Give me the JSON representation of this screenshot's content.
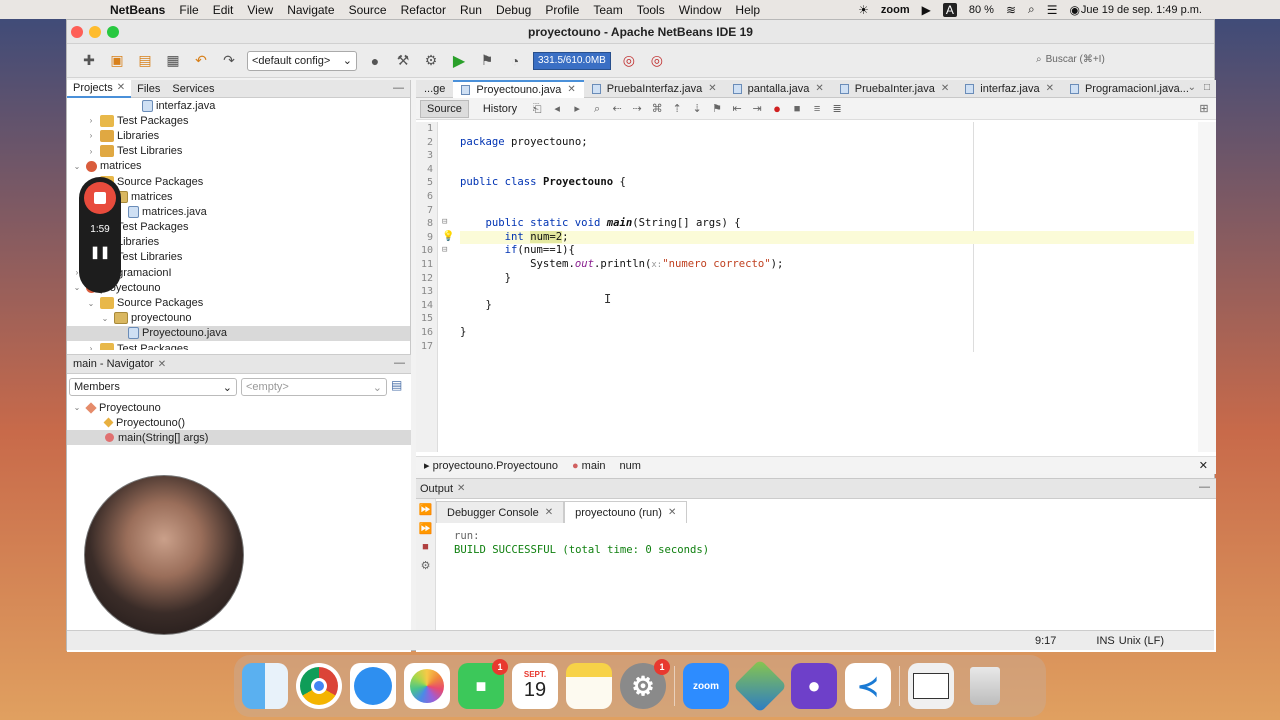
{
  "menubar": {
    "app_name": "NetBeans",
    "items": [
      "File",
      "Edit",
      "View",
      "Navigate",
      "Source",
      "Refactor",
      "Run",
      "Debug",
      "Profile",
      "Team",
      "Tools",
      "Window",
      "Help"
    ],
    "zoom_label": "zoom",
    "battery": "80 %",
    "clock": "Jue 19 de sep.  1:49 p.m."
  },
  "window": {
    "title": "proyectouno - Apache NetBeans IDE 19"
  },
  "toolbar": {
    "config": "<default config>",
    "memory": "331.5/610.0MB",
    "search_placeholder": "Buscar (⌘+I)"
  },
  "projects_panel": {
    "tabs": [
      "Projects",
      "Files",
      "Services"
    ],
    "tree": [
      {
        "label": "interfaz.java",
        "indent": 4,
        "icon": "java",
        "twisty": ""
      },
      {
        "label": "Test Packages",
        "indent": 1,
        "icon": "folder",
        "twisty": "›"
      },
      {
        "label": "Libraries",
        "indent": 1,
        "icon": "lib",
        "twisty": "›"
      },
      {
        "label": "Test Libraries",
        "indent": 1,
        "icon": "lib",
        "twisty": "›"
      },
      {
        "label": "matrices",
        "indent": 0,
        "icon": "project",
        "twisty": "⌄"
      },
      {
        "label": "Source Packages",
        "indent": 1,
        "icon": "folder",
        "twisty": "⌄"
      },
      {
        "label": "matrices",
        "indent": 2,
        "icon": "pkg",
        "twisty": "⌄"
      },
      {
        "label": "matrices.java",
        "indent": 3,
        "icon": "java",
        "twisty": ""
      },
      {
        "label": "Test Packages",
        "indent": 1,
        "icon": "folder",
        "twisty": "›"
      },
      {
        "label": "Libraries",
        "indent": 1,
        "icon": "lib",
        "twisty": "›"
      },
      {
        "label": "Test Libraries",
        "indent": 1,
        "icon": "lib",
        "twisty": "›"
      },
      {
        "label": "ProgramacionI",
        "indent": 0,
        "icon": "project",
        "twisty": "›"
      },
      {
        "label": "proyectouno",
        "indent": 0,
        "icon": "project",
        "twisty": "⌄"
      },
      {
        "label": "Source Packages",
        "indent": 1,
        "icon": "folder",
        "twisty": "⌄"
      },
      {
        "label": "proyectouno",
        "indent": 2,
        "icon": "pkg",
        "twisty": "⌄"
      },
      {
        "label": "Proyectouno.java",
        "indent": 3,
        "icon": "java",
        "twisty": "",
        "selected": true
      },
      {
        "label": "Test Packages",
        "indent": 1,
        "icon": "folder",
        "twisty": "›"
      }
    ]
  },
  "navigator": {
    "title": "main - Navigator",
    "filter": "Members",
    "filter2": "<empty>",
    "items": [
      {
        "label": "Proyectouno",
        "icon": "class",
        "indent": 0,
        "twisty": "⌄"
      },
      {
        "label": "Proyectouno()",
        "icon": "ctor",
        "indent": 1,
        "twisty": ""
      },
      {
        "label": "main(String[] args)",
        "icon": "method",
        "indent": 1,
        "twisty": "",
        "selected": true
      }
    ]
  },
  "recording": {
    "time": "1:59"
  },
  "editor": {
    "tabs": [
      "...ge",
      "Proyectouno.java",
      "PruebaInterfaz.java",
      "pantalla.java",
      "PruebaInter.java",
      "interfaz.java",
      "ProgramacionI.java..."
    ],
    "active_tab": 1,
    "source_tab": "Source",
    "history_tab": "History",
    "line_numbers": [
      "1",
      "2",
      "3",
      "4",
      "5",
      "6",
      "7",
      "8",
      "9",
      "10",
      "11",
      "12",
      "13",
      "14",
      "15",
      "16",
      "17"
    ],
    "code": {
      "l2_kw": "package",
      "l2_rest": " proyectouno;",
      "l5_kw": "public class",
      "l5_cls": "Proyectouno",
      "l5_rest": " {",
      "l8_kw1": "public static void",
      "l8_meth": "main",
      "l8_rest": "(String[] args) {",
      "l9_kw": "int",
      "l9_var": "num=2",
      "l9_rest": ";",
      "l10_kw": "if",
      "l10_rest": "(num==1){",
      "l11_pre": "System.",
      "l11_fld": "out",
      "l11_mid": ".println(",
      "l11_hint": "x:",
      "l11_str": "\"numero correcto\"",
      "l11_end": ");",
      "l12": "}",
      "l14": "}",
      "l16": "}"
    },
    "breadcrumb": [
      "proyectouno.Proyectouno",
      "main",
      "num"
    ]
  },
  "output": {
    "title": "Output",
    "tabs": [
      "Debugger Console",
      "proyectouno (run)"
    ],
    "lines": [
      "run:",
      "BUILD SUCCESSFUL (total time: 0 seconds)"
    ]
  },
  "statusbar": {
    "position": "9:17",
    "mode": "INS",
    "line_ending": "Unix (LF)"
  },
  "dock": {
    "calendar_month": "SEPT.",
    "calendar_day": "19",
    "facetime_badge": "1",
    "settings_badge": "1",
    "zoom_label": "zoom"
  },
  "colors": {
    "accent": "#4a90d9",
    "keyword": "#0033b3",
    "success": "#108010",
    "memory_bar": "#3a6fc4"
  }
}
